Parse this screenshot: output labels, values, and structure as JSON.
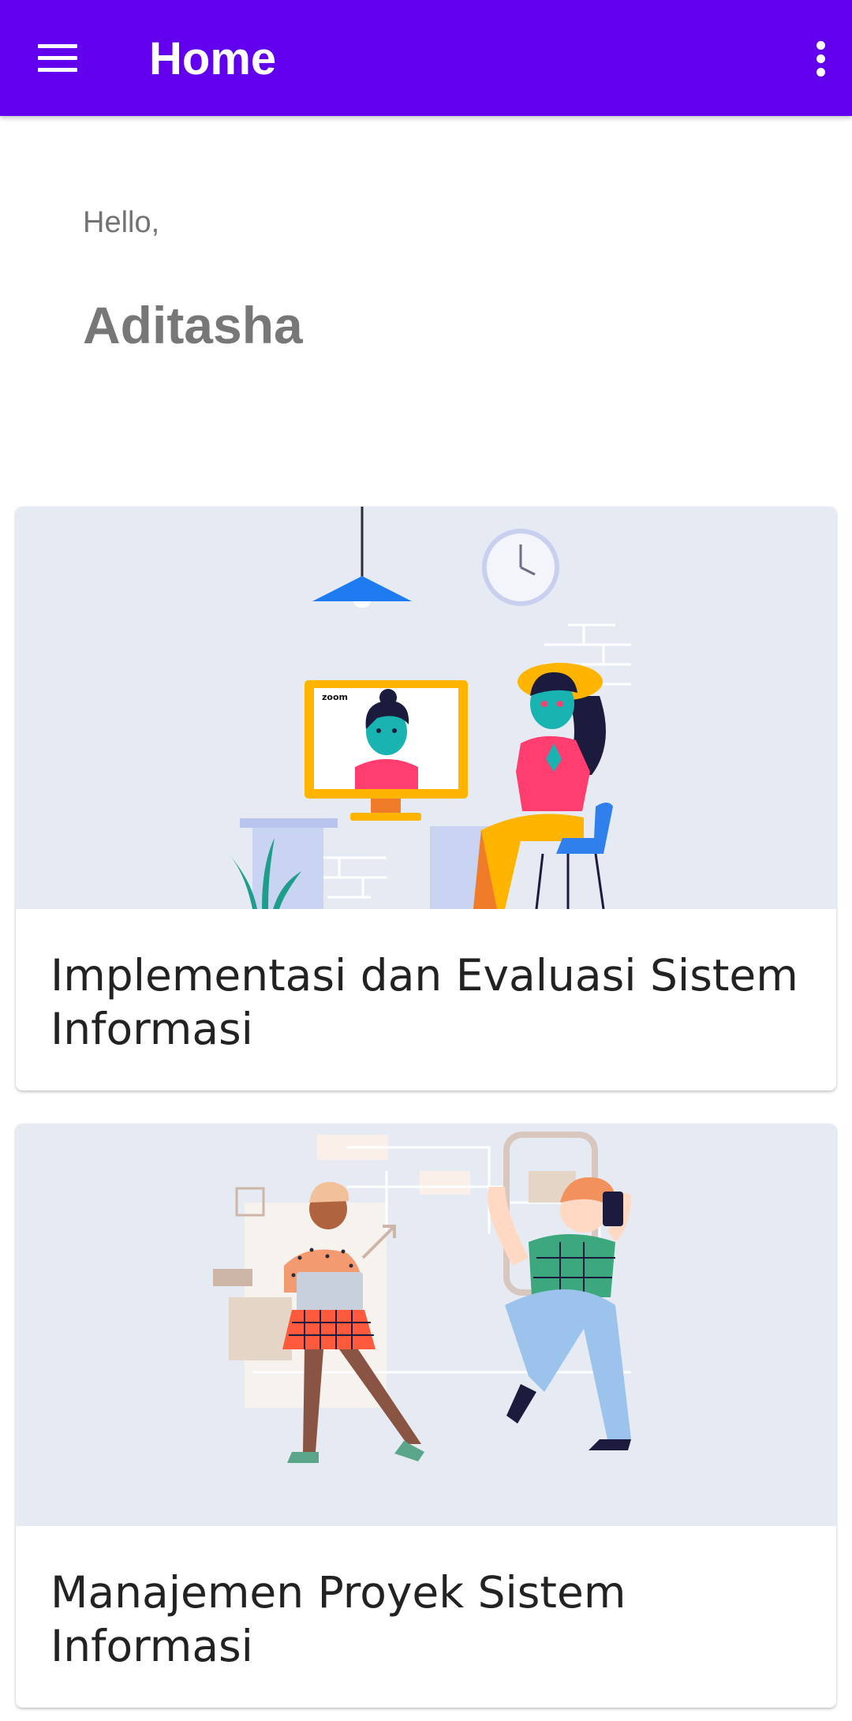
{
  "app_bar": {
    "title": "Home",
    "menu_icon": "hamburger-menu-icon",
    "more_icon": "more-vertical-icon",
    "background": "#6200EE"
  },
  "greeting": {
    "hello": "Hello,",
    "name": "Aditasha"
  },
  "courses": [
    {
      "title": "Implementasi dan Evaluasi Sistem Informasi",
      "image": "video-call-illustration"
    },
    {
      "title": "Manajemen Proyek Sistem Informasi",
      "image": "team-collaboration-illustration"
    }
  ],
  "illustration_text": {
    "monitor_label": "zoom"
  }
}
